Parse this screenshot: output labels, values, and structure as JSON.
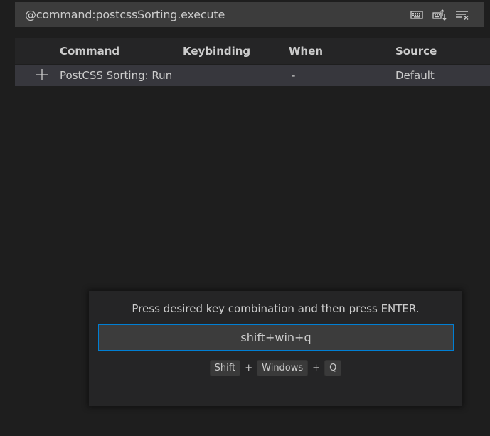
{
  "search": {
    "value": "@command:postcssSorting.execute"
  },
  "search_actions": [
    {
      "icon": "keyboard-icon",
      "name": "record-keys-icon"
    },
    {
      "icon": "sort-by-precedence-icon",
      "name": "sort-precedence-icon"
    },
    {
      "icon": "clear-filter-icon",
      "name": "clear-search-icon"
    }
  ],
  "table": {
    "headers": {
      "command": "Command",
      "keybinding": "Keybinding",
      "when": "When",
      "source": "Source"
    },
    "rows": [
      {
        "command": "PostCSS Sorting: Run",
        "keybinding": "",
        "when": "-",
        "source": "Default"
      }
    ]
  },
  "key_dialog": {
    "message": "Press desired key combination and then press ENTER.",
    "input_value": "shift+win+q",
    "keys": [
      "Shift",
      "Windows",
      "Q"
    ],
    "separator": "+"
  },
  "colors": {
    "background": "#1e1e1e",
    "input_background": "#3c3c3c",
    "focus_border": "#007fd4",
    "row_selected": "#37373d"
  }
}
